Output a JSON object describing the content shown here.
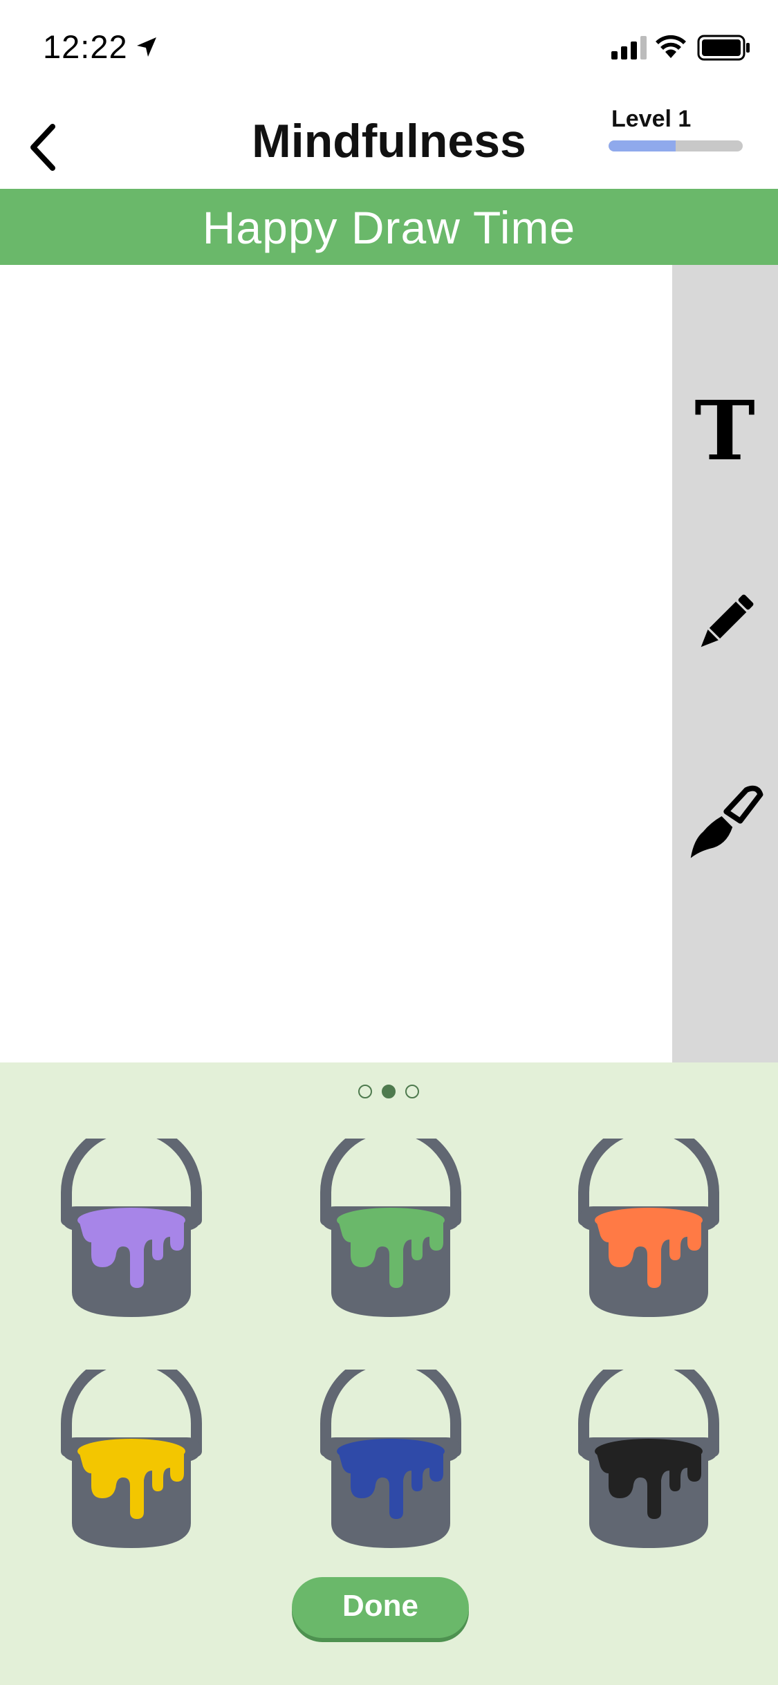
{
  "status_bar": {
    "time": "12:22"
  },
  "nav": {
    "title": "Mindfulness",
    "level_label": "Level 1",
    "level_progress": 0.5
  },
  "banner": {
    "title": "Happy Draw Time"
  },
  "toolbar": {
    "text_tool_glyph": "T",
    "tools": [
      "text-icon",
      "pencil-icon",
      "brush-icon"
    ]
  },
  "palette": {
    "page_count": 3,
    "active_page": 2,
    "colors": [
      {
        "name": "purple",
        "hex": "#a785e8"
      },
      {
        "name": "green",
        "hex": "#6ab86a"
      },
      {
        "name": "orange",
        "hex": "#ff7a45"
      },
      {
        "name": "yellow",
        "hex": "#f3c600"
      },
      {
        "name": "blue",
        "hex": "#2f4aa8"
      },
      {
        "name": "black",
        "hex": "#222222"
      }
    ],
    "done_label": "Done"
  }
}
